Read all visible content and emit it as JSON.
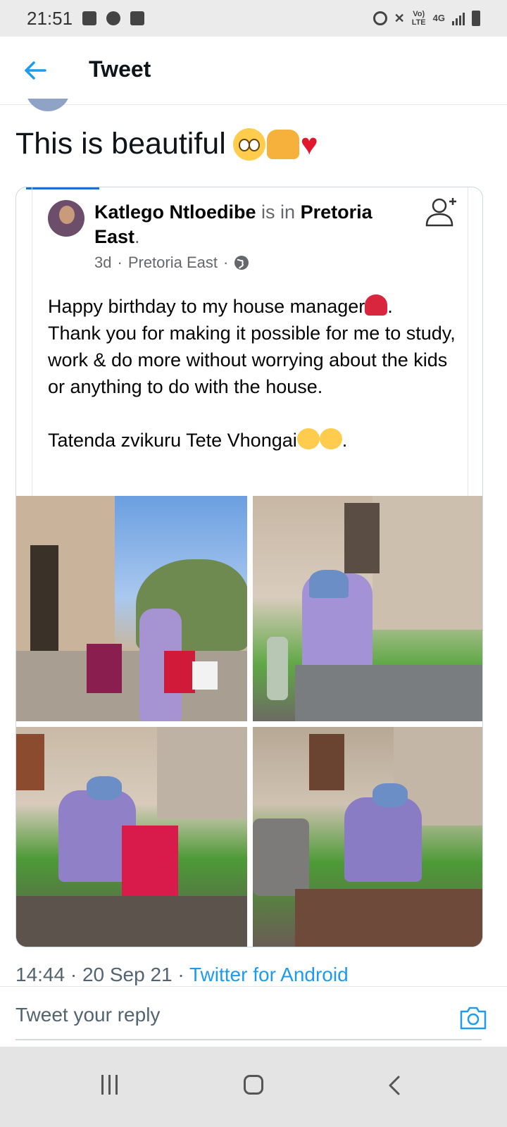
{
  "status_bar": {
    "time": "21:51",
    "network_volte": "Vo)\nLTE",
    "network_4g": "4G",
    "icons": [
      "image-icon",
      "gear-icon",
      "check-icon",
      "alarm-icon",
      "mute-icon",
      "signal-icon",
      "battery-icon"
    ]
  },
  "header": {
    "title": "Tweet",
    "back_icon": "arrow-left-icon"
  },
  "tweet": {
    "text": "This is beautiful",
    "emojis": [
      "pleading-face",
      "raising-hands",
      "red-heart"
    ]
  },
  "embedded_post": {
    "author": "Katlego Ntloedibe",
    "connector": "is in",
    "place": "Pretoria East",
    "place_suffix": ".",
    "time_ago": "3d",
    "location": "Pretoria East",
    "separator": "·",
    "body_lines": [
      "Happy birthday to my house manager",
      "Thank you for making it possible for me to study, work & do more without worrying about the kids or anything to do with the house."
    ],
    "closing": "Tatenda zvikuru Tete Vhongai",
    "closing_suffix": ".",
    "body_line1_suffix": "."
  },
  "timestamp": {
    "time": "14:44 · 20 Sep 21 · ",
    "app": "Twitter for Android"
  },
  "reply": {
    "placeholder": "Tweet your reply"
  },
  "colors": {
    "accent": "#1d9bf0",
    "text": "#0f1419",
    "muted": "#536471"
  }
}
